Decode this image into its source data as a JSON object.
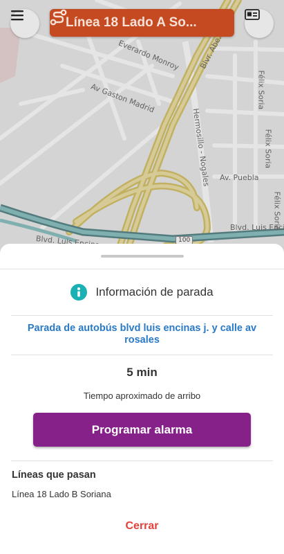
{
  "header": {
    "route_label": "Línea 18 Lado A So...",
    "route_color": "#c54a21"
  },
  "map": {
    "streets": {
      "everardo": "Everardo Monroy",
      "gaston": "Av Gaston Madrid",
      "abelardo": "Blvr. Abe...",
      "hermosillo": "Hermosillo - Nogales",
      "puebla": "Av. Puebla",
      "felix1": "Félix Soria",
      "felix2": "Félix Soria",
      "felix3": "Félix Soria",
      "encinas_right": "Blvd. Luis Enci",
      "encinas_left": "Blvd. Luis Encinas",
      "shield": "100"
    }
  },
  "sheet": {
    "title": "Información de parada",
    "stop_name": "Parada de autobús blvd luis encinas j. y calle av rosales",
    "eta_value": "5 min",
    "eta_label": "Tiempo aproximado de arribo",
    "alarm_button": "Programar alarma",
    "lines_title": "Líneas que pasan",
    "lines": [
      "Línea 18 Lado B Soriana"
    ],
    "close_button": "Cerrar"
  },
  "colors": {
    "accent_purple": "#86218a",
    "link_blue": "#2879c6",
    "info_teal": "#1bb0b3",
    "close_red": "#e2403a"
  },
  "icons": [
    "menu-icon",
    "route-icon",
    "id-card-icon",
    "info-icon"
  ]
}
